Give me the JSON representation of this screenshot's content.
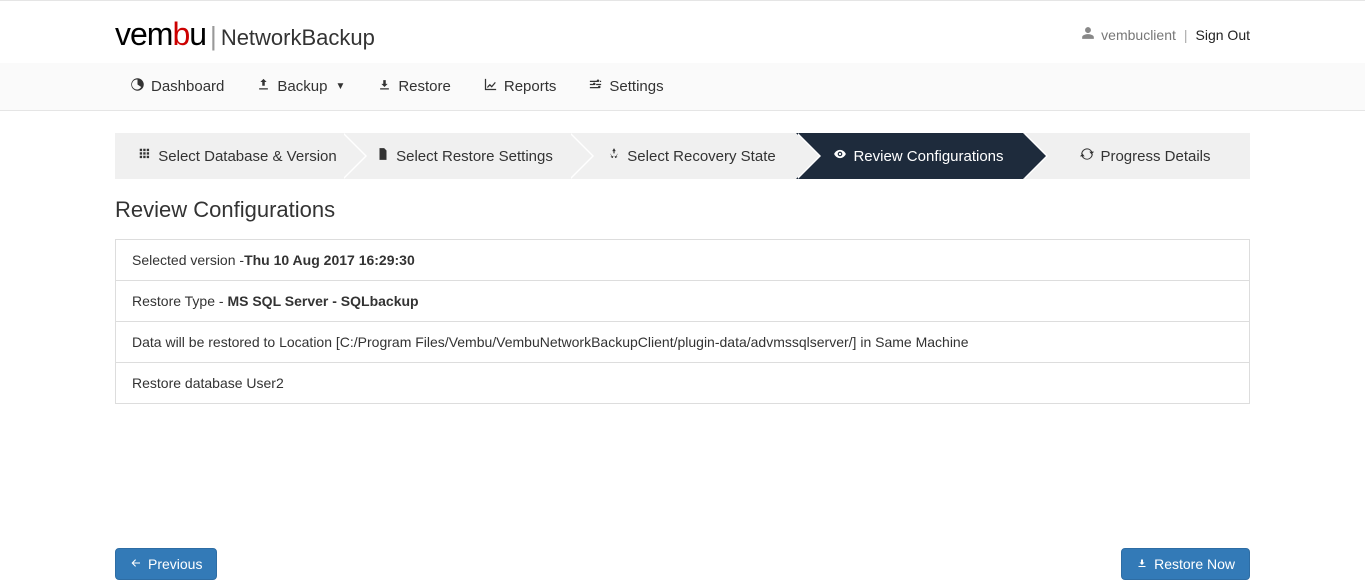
{
  "header": {
    "logo_prefix": "vem",
    "logo_b": "b",
    "logo_suffix": "u",
    "product": "NetworkBackup",
    "username": "vembuclient",
    "signout": "Sign Out"
  },
  "nav": {
    "dashboard": "Dashboard",
    "backup": "Backup",
    "restore": "Restore",
    "reports": "Reports",
    "settings": "Settings"
  },
  "wizard": {
    "step1": "Select Database & Version",
    "step2": "Select Restore Settings",
    "step3": "Select Recovery State",
    "step4": "Review Configurations",
    "step5": "Progress Details"
  },
  "page": {
    "title": "Review Configurations"
  },
  "config": {
    "version_label": "Selected version -",
    "version_value": "Thu 10 Aug 2017 16:29:30",
    "restore_type_label": "Restore Type - ",
    "restore_type_value": "MS SQL Server - SQLbackup",
    "location_text": "Data will be restored to Location [C:/Program Files/Vembu/VembuNetworkBackupClient/plugin-data/advmssqlserver/] in Same Machine",
    "database_text": "Restore database User2"
  },
  "buttons": {
    "previous": "Previous",
    "restore_now": "Restore Now"
  }
}
